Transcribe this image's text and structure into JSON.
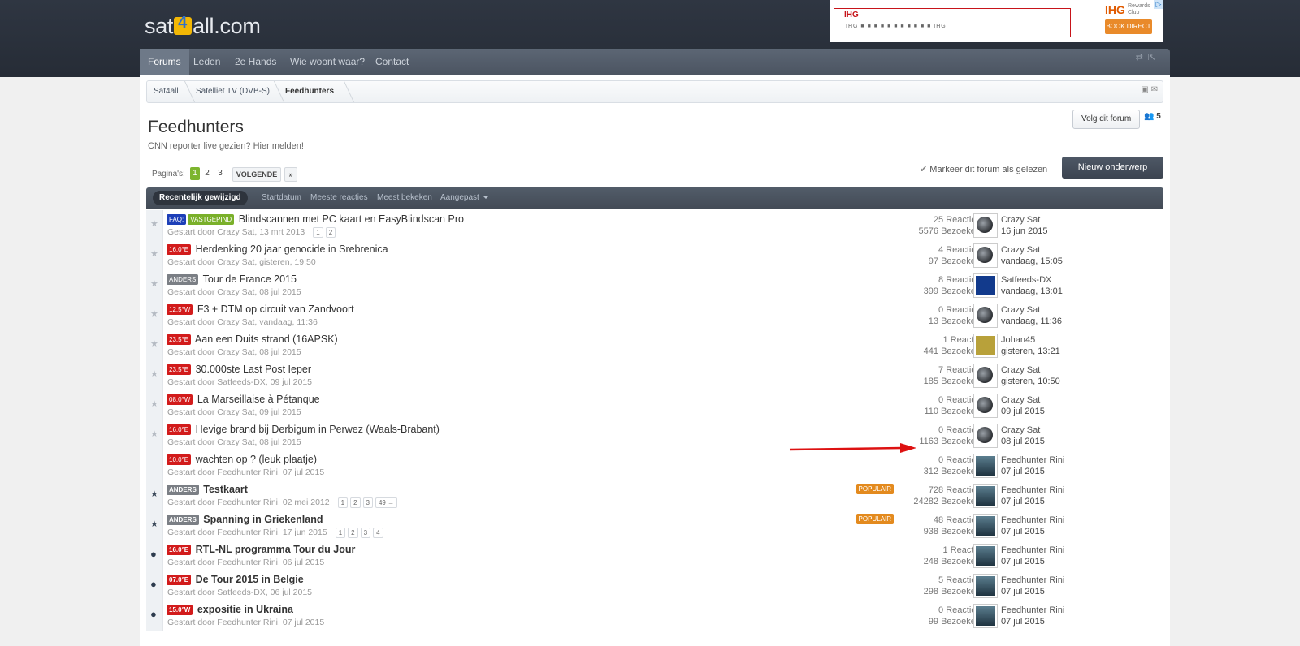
{
  "site": {
    "logo_pre": "sat",
    "logo_post": "all.com"
  },
  "ad": {
    "brand": "IHG",
    "club": "Rewards Club",
    "book": "BOOK DIRECT",
    "strip": "IHG ■ ■ ■ ■ ■ ■ ■ ■ ■ ■ ■ IHG",
    "adchoice": "▷"
  },
  "nav": {
    "items": [
      "Forums",
      "Leden",
      "2e Hands",
      "Wie woont waar?",
      "Contact"
    ]
  },
  "breadcrumb": [
    "Sat4all",
    "Satelliet TV (DVB-S)",
    "Feedhunters"
  ],
  "forum": {
    "title": "Feedhunters",
    "description": "CNN reporter live gezien? Hier melden!",
    "follow": "Volg dit forum",
    "watchers": "5"
  },
  "pager": {
    "label": "Pagina's:",
    "pages": [
      "1",
      "2",
      "3"
    ],
    "next": "VOLGENDE",
    "arrow": "»"
  },
  "actions": {
    "mark_read": "Markeer dit forum als gelezen",
    "new_topic": "Nieuw onderwerp"
  },
  "sort": {
    "items": [
      "Recentelijk gewijzigd",
      "Startdatum",
      "Meeste reacties",
      "Meest bekeken",
      "Aangepast"
    ]
  },
  "threads": [
    {
      "prefixes": [
        {
          "t": "FAQ:",
          "c": "p-faq"
        },
        {
          "t": "VASTGEPIND",
          "c": "p-vast"
        }
      ],
      "title": "Blindscannen met PC kaart en EasyBlindscan Pro",
      "meta": "Gestart door Crazy Sat, 13 mrt 2013",
      "pages": [
        "1",
        "2"
      ],
      "replies": "25 Reacties",
      "views": "5576 Bezoeken",
      "user": "Crazy Sat",
      "date": "16 jun 2015",
      "av": "sat",
      "marker": "star",
      "unread": false
    },
    {
      "prefixes": [
        {
          "t": "16.0°E",
          "c": "p-red"
        }
      ],
      "title": "Herdenking 20 jaar genocide in Srebrenica",
      "meta": "Gestart door Crazy Sat, gisteren, 19:50",
      "pages": [],
      "replies": "4 Reacties",
      "views": "97 Bezoeken",
      "user": "Crazy Sat",
      "date": "vandaag, 15:05",
      "av": "sat",
      "marker": "star",
      "unread": false
    },
    {
      "prefixes": [
        {
          "t": "ANDERS",
          "c": "p-grey"
        }
      ],
      "title": "Tour de France 2015",
      "meta": "Gestart door Crazy Sat, 08 jul 2015",
      "pages": [],
      "replies": "8 Reacties",
      "views": "399 Bezoeken",
      "user": "Satfeeds-DX",
      "date": "vandaag, 13:01",
      "av": "blue",
      "marker": "star",
      "unread": false
    },
    {
      "prefixes": [
        {
          "t": "12.5°W",
          "c": "p-red"
        }
      ],
      "title": "F3 + DTM op circuit van Zandvoort",
      "meta": "Gestart door Crazy Sat, vandaag, 11:36",
      "pages": [],
      "replies": "0 Reacties",
      "views": "13 Bezoeken",
      "user": "Crazy Sat",
      "date": "vandaag, 11:36",
      "av": "sat",
      "marker": "star",
      "unread": false
    },
    {
      "prefixes": [
        {
          "t": "23.5°E",
          "c": "p-red"
        }
      ],
      "title": "Aan een Duits strand (16APSK)",
      "meta": "Gestart door Crazy Sat, 08 jul 2015",
      "pages": [],
      "replies": "1 Reactie",
      "views": "441 Bezoeken",
      "user": "Johan45",
      "date": "gisteren, 13:21",
      "av": "johan",
      "marker": "star",
      "unread": false
    },
    {
      "prefixes": [
        {
          "t": "23.5°E",
          "c": "p-red"
        }
      ],
      "title": "30.000ste Last Post Ieper",
      "meta": "Gestart door Satfeeds-DX, 09 jul 2015",
      "pages": [],
      "replies": "7 Reacties",
      "views": "185 Bezoeken",
      "user": "Crazy Sat",
      "date": "gisteren, 10:50",
      "av": "sat",
      "marker": "star",
      "unread": false
    },
    {
      "prefixes": [
        {
          "t": "08.0°W",
          "c": "p-red"
        }
      ],
      "title": "La Marseillaise à Pétanque",
      "meta": "Gestart door Crazy Sat, 09 jul 2015",
      "pages": [],
      "replies": "0 Reacties",
      "views": "110 Bezoeken",
      "user": "Crazy Sat",
      "date": "09 jul 2015",
      "av": "sat",
      "marker": "star",
      "unread": false
    },
    {
      "prefixes": [
        {
          "t": "16.0°E",
          "c": "p-red"
        }
      ],
      "title": "Hevige brand bij Derbigum in Perwez (Waals-Brabant)",
      "meta": "Gestart door Crazy Sat, 08 jul 2015",
      "pages": [],
      "replies": "0 Reacties",
      "views": "1163 Bezoeken",
      "user": "Crazy Sat",
      "date": "08 jul 2015",
      "av": "sat",
      "marker": "star",
      "unread": false
    },
    {
      "prefixes": [
        {
          "t": "10.0°E",
          "c": "p-red"
        }
      ],
      "title": "wachten op ? (leuk plaatje)",
      "meta": "Gestart door Feedhunter Rini, 07 jul 2015",
      "pages": [],
      "replies": "0 Reacties",
      "views": "312 Bezoeken",
      "user": "Feedhunter Rini",
      "date": "07 jul 2015",
      "av": "rini",
      "marker": "none",
      "unread": false
    },
    {
      "prefixes": [
        {
          "t": "ANDERS",
          "c": "p-grey"
        }
      ],
      "title": "Testkaart",
      "meta": "Gestart door Feedhunter Rini, 02 mei 2012",
      "pages": [
        "1",
        "2",
        "3",
        "49 →"
      ],
      "popular": "POPULAIR",
      "replies": "728 Reacties",
      "views": "24282 Bezoeken",
      "user": "Feedhunter Rini",
      "date": "07 jul 2015",
      "av": "rini",
      "marker": "sticky",
      "unread": true
    },
    {
      "prefixes": [
        {
          "t": "ANDERS",
          "c": "p-grey"
        }
      ],
      "title": "Spanning in Griekenland",
      "meta": "Gestart door Feedhunter Rini, 17 jun 2015",
      "pages": [
        "1",
        "2",
        "3",
        "4"
      ],
      "popular": "POPULAIR",
      "replies": "48 Reacties",
      "views": "938 Bezoeken",
      "user": "Feedhunter Rini",
      "date": "07 jul 2015",
      "av": "rini",
      "marker": "sticky",
      "unread": true
    },
    {
      "prefixes": [
        {
          "t": "16.0°E",
          "c": "p-red"
        }
      ],
      "title": "RTL-NL programma Tour du Jour",
      "meta": "Gestart door Feedhunter Rini, 06 jul 2015",
      "pages": [],
      "replies": "1 Reactie",
      "views": "248 Bezoeken",
      "user": "Feedhunter Rini",
      "date": "07 jul 2015",
      "av": "rini",
      "marker": "dot",
      "unread": true
    },
    {
      "prefixes": [
        {
          "t": "07.0°E",
          "c": "p-red"
        }
      ],
      "title": "De Tour 2015 in Belgie",
      "meta": "Gestart door Satfeeds-DX, 06 jul 2015",
      "pages": [],
      "replies": "5 Reacties",
      "views": "298 Bezoeken",
      "user": "Feedhunter Rini",
      "date": "07 jul 2015",
      "av": "rini",
      "marker": "dot",
      "unread": true
    },
    {
      "prefixes": [
        {
          "t": "15.0°W",
          "c": "p-red"
        }
      ],
      "title": "expositie in Ukraina",
      "meta": "Gestart door Feedhunter Rini, 07 jul 2015",
      "pages": [],
      "replies": "0 Reacties",
      "views": "99 Bezoeken",
      "user": "Feedhunter Rini",
      "date": "07 jul 2015",
      "av": "rini",
      "marker": "dot",
      "unread": true
    }
  ]
}
